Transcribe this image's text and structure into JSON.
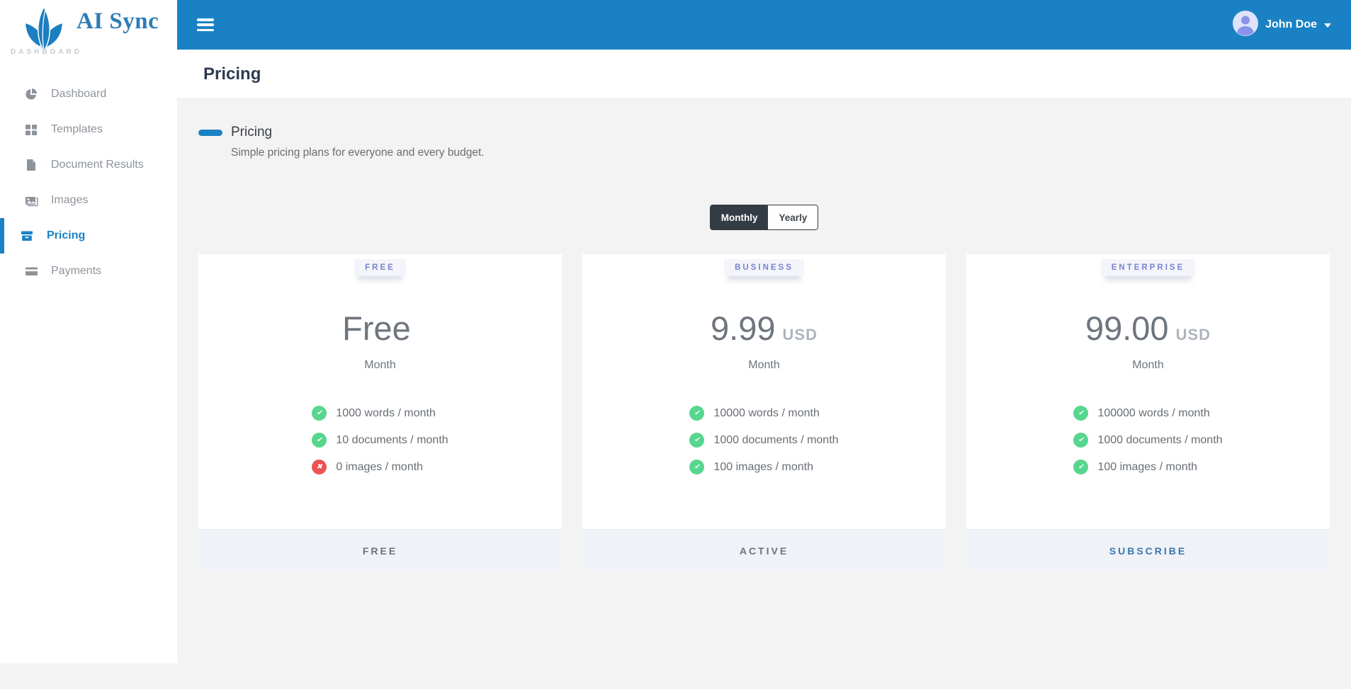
{
  "brand": {
    "name": "AI Sync",
    "tagline": "DASHBOARD"
  },
  "topbar": {
    "user_name": "John Doe"
  },
  "sidebar": {
    "items": [
      {
        "label": "Dashboard",
        "icon": "pie-chart",
        "active": false
      },
      {
        "label": "Templates",
        "icon": "grid",
        "active": false
      },
      {
        "label": "Document Results",
        "icon": "document",
        "active": false
      },
      {
        "label": "Images",
        "icon": "images",
        "active": false
      },
      {
        "label": "Pricing",
        "icon": "archive-box",
        "active": true
      },
      {
        "label": "Payments",
        "icon": "credit-card",
        "active": false
      }
    ]
  },
  "page": {
    "title": "Pricing"
  },
  "section": {
    "title": "Pricing",
    "subtitle": "Simple pricing plans for everyone and every budget."
  },
  "billing_toggle": {
    "options": [
      {
        "label": "Monthly",
        "active": true
      },
      {
        "label": "Yearly",
        "active": false
      }
    ]
  },
  "plans": [
    {
      "badge": "FREE",
      "price": "Free",
      "currency": "",
      "period": "Month",
      "features": [
        {
          "text": "1000 words / month",
          "ok": true
        },
        {
          "text": "10 documents / month",
          "ok": true
        },
        {
          "text": "0 images / month",
          "ok": false
        }
      ],
      "action": "FREE",
      "action_primary": false
    },
    {
      "badge": "BUSINESS",
      "price": "9.99",
      "currency": "USD",
      "period": "Month",
      "features": [
        {
          "text": "10000 words / month",
          "ok": true
        },
        {
          "text": "1000 documents / month",
          "ok": true
        },
        {
          "text": "100 images / month",
          "ok": true
        }
      ],
      "action": "ACTIVE",
      "action_primary": false
    },
    {
      "badge": "ENTERPRISE",
      "price": "99.00",
      "currency": "USD",
      "period": "Month",
      "features": [
        {
          "text": "100000 words / month",
          "ok": true
        },
        {
          "text": "1000 documents / month",
          "ok": true
        },
        {
          "text": "100 images / month",
          "ok": true
        }
      ],
      "action": "SUBSCRIBE",
      "action_primary": true
    }
  ],
  "colors": {
    "brand_blue": "#1a82c4",
    "success_green": "#57d68d",
    "danger_red": "#ec5353",
    "subscribe_blue": "#3a78b0",
    "badge_text": "#7b83cf",
    "title_navy": "#2f3a52"
  }
}
